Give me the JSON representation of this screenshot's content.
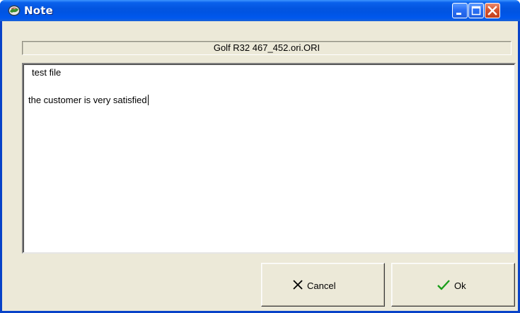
{
  "window": {
    "title": "Note",
    "accent_color": "#0054e3",
    "close_color": "#d6542e",
    "icons": [
      "app-globe-icon",
      "minimize-icon",
      "maximize-icon",
      "close-icon"
    ]
  },
  "file": {
    "name": "Golf R32 467_452.ori.ORI"
  },
  "note": {
    "line1": "test file",
    "line2": "the customer is very satisfied"
  },
  "buttons": {
    "cancel_label": "Cancel",
    "cancel_icon": "x-icon",
    "ok_label": "Ok",
    "ok_icon": "checkmark-icon",
    "ok_icon_color": "#1a9e1a"
  }
}
